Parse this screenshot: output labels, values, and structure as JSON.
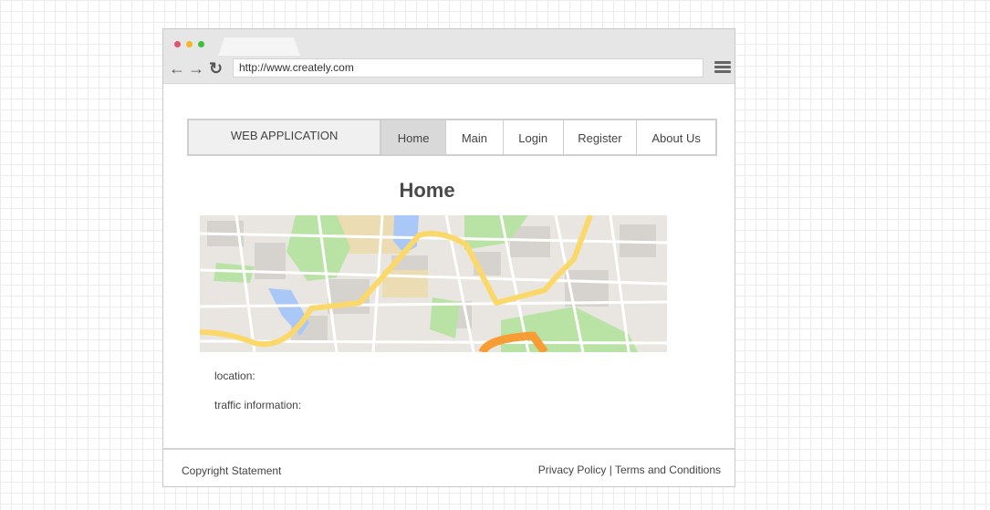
{
  "browser": {
    "url": "http://www.creately.com",
    "traffic_light_colors": [
      "#e0556b",
      "#f5b62a",
      "#3cc13b"
    ]
  },
  "site": {
    "brand": "WEB APPLICATION",
    "nav": [
      "Home",
      "Main",
      "Login",
      "Register",
      "About Us"
    ],
    "active_nav": "Home"
  },
  "page": {
    "title": "Home",
    "fields": [
      "location:",
      "traffic information:"
    ]
  },
  "footer": {
    "copyright": "Copyright Statement",
    "links": "Privacy Policy | Terms and Conditions"
  },
  "icons": [
    "back-arrow-icon",
    "forward-arrow-icon",
    "reload-icon",
    "hamburger-menu-icon"
  ],
  "colors": {
    "map_park": "#b9e3a5",
    "map_water": "#a9c8f7",
    "map_road": "#fbd86a",
    "map_highway": "#f89c36"
  }
}
